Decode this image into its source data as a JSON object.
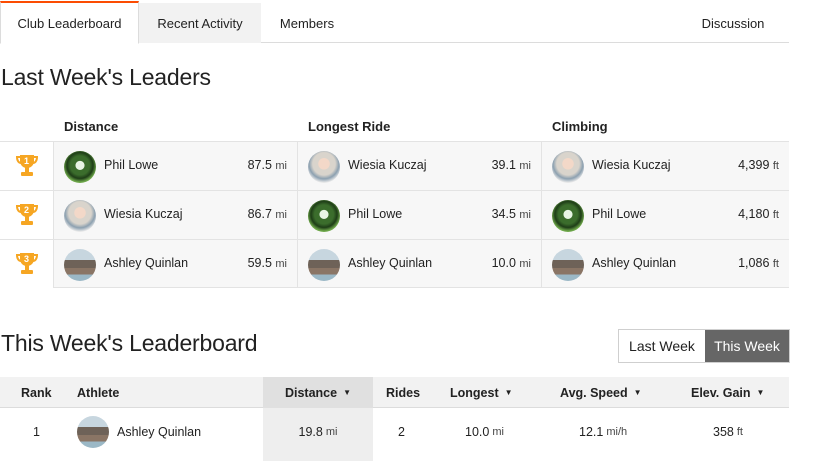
{
  "tabs": [
    {
      "label": "Club Leaderboard"
    },
    {
      "label": "Recent Activity"
    },
    {
      "label": "Members"
    },
    {
      "label": "Discussion"
    }
  ],
  "last_week": {
    "title": "Last Week's Leaders",
    "columns": [
      "Distance",
      "Longest Ride",
      "Climbing"
    ],
    "rows": [
      {
        "rank": "1",
        "cells": [
          {
            "name": "Phil Lowe",
            "value": "87.5",
            "unit": "mi",
            "avatar": "phil"
          },
          {
            "name": "Wiesia Kuczaj",
            "value": "39.1",
            "unit": "mi",
            "avatar": "wiesia"
          },
          {
            "name": "Wiesia Kuczaj",
            "value": "4,399",
            "unit": "ft",
            "avatar": "wiesia"
          }
        ]
      },
      {
        "rank": "2",
        "cells": [
          {
            "name": "Wiesia Kuczaj",
            "value": "86.7",
            "unit": "mi",
            "avatar": "wiesia"
          },
          {
            "name": "Phil Lowe",
            "value": "34.5",
            "unit": "mi",
            "avatar": "phil"
          },
          {
            "name": "Phil Lowe",
            "value": "4,180",
            "unit": "ft",
            "avatar": "phil"
          }
        ]
      },
      {
        "rank": "3",
        "cells": [
          {
            "name": "Ashley Quinlan",
            "value": "59.5",
            "unit": "mi",
            "avatar": "ashley"
          },
          {
            "name": "Ashley Quinlan",
            "value": "10.0",
            "unit": "mi",
            "avatar": "ashley"
          },
          {
            "name": "Ashley Quinlan",
            "value": "1,086",
            "unit": "ft",
            "avatar": "ashley"
          }
        ]
      }
    ],
    "trophy_color": "#f6a623"
  },
  "this_week": {
    "title": "This Week's Leaderboard",
    "toggle": {
      "last": "Last Week",
      "this": "This Week"
    },
    "headers": [
      "Rank",
      "Athlete",
      "Distance",
      "Rides",
      "Longest",
      "Avg. Speed",
      "Elev. Gain"
    ],
    "rows": [
      {
        "rank": "1",
        "athlete": "Ashley Quinlan",
        "distance": "19.8",
        "distance_unit": "mi",
        "rides": "2",
        "longest": "10.0",
        "longest_unit": "mi",
        "avg_speed": "12.1",
        "avg_speed_unit": "mi/h",
        "elev_gain": "358",
        "elev_gain_unit": "ft"
      }
    ]
  },
  "colors": {
    "accent": "#fc4c02",
    "toggle_active": "#666666"
  }
}
